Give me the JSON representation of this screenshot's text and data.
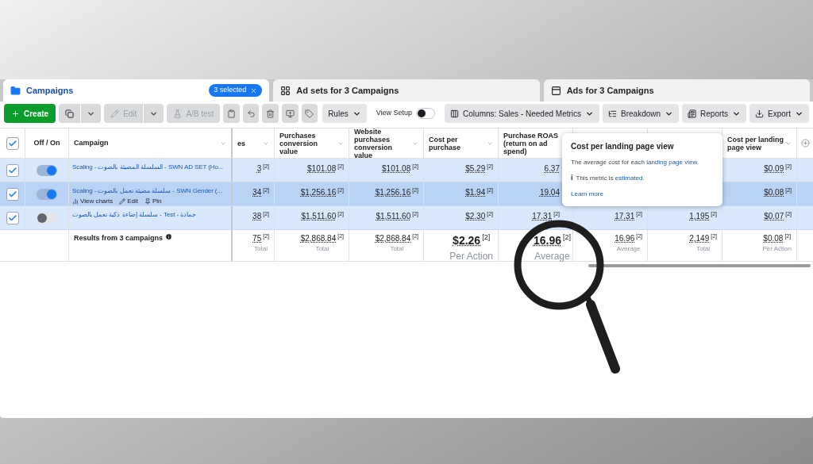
{
  "tabs": [
    {
      "label": "Campaigns",
      "selected": true,
      "badge": "3 selected"
    },
    {
      "label": "Ad sets for 3 Campaigns",
      "selected": false
    },
    {
      "label": "Ads for 3 Campaigns",
      "selected": false
    }
  ],
  "toolbar": [
    {
      "kind": "create",
      "label": "Create"
    },
    {
      "kind": "split"
    },
    {
      "kind": "split",
      "label": "Edit",
      "disabled": true
    },
    {
      "kind": "button",
      "label": "A/B test",
      "disabled": true
    },
    {
      "kind": "icon"
    },
    {
      "kind": "icon"
    },
    {
      "kind": "icon"
    },
    {
      "kind": "icon"
    },
    {
      "kind": "icon"
    },
    {
      "kind": "menu",
      "label": "Rules"
    },
    {
      "kind": "switch",
      "label": "View Setup",
      "on": false
    },
    {
      "kind": "menu",
      "label": "Columns: Sales - Needed Metrics"
    },
    {
      "kind": "menu",
      "label": "Breakdown"
    },
    {
      "kind": "menu",
      "label": "Reports"
    },
    {
      "kind": "menu",
      "label": "Export"
    }
  ],
  "table": {
    "all_checked": true,
    "onoff_label": "Off / On",
    "name_label": "Campaign",
    "columns": [
      {
        "label": "es",
        "menu": true
      },
      {
        "label": "Purchases conversion value",
        "menu": true
      },
      {
        "label": "Website purchases conversion value",
        "menu": true
      },
      {
        "label": "Cost per purchase",
        "menu": true
      },
      {
        "label": "Purchase ROAS (return on ad spend)"
      },
      {},
      {},
      {
        "label": "Cost per landing page view",
        "menu": true
      }
    ],
    "rows": [
      {
        "checked": true,
        "on": true,
        "hovered": false,
        "name": "Scaling - السلسلة المضيئة بالصوت - SWN AD SET (Ho...",
        "values": [
          {
            "v": "3",
            "note": "[2]"
          },
          {
            "v": "$101.08",
            "note": "[2]"
          },
          {
            "v": "$101.08",
            "note": "[2]"
          },
          {
            "v": "$5.29",
            "note": "[2]"
          },
          {
            "v": "6.37"
          }
        ],
        "values_right": [
          {
            "v": "$0.09",
            "note": "[2]"
          }
        ]
      },
      {
        "checked": true,
        "on": true,
        "hovered": true,
        "name": "Scaling - سلسلة مضيئة تعمل بالصوت - SWN Gender (...",
        "actions": [
          "View charts",
          "Edit",
          "Pin"
        ],
        "values": [
          {
            "v": "34",
            "note": "[2]"
          },
          {
            "v": "$1,256.16",
            "note": "[2]"
          },
          {
            "v": "$1,256.16",
            "note": "[2]"
          },
          {
            "v": "$1.94",
            "note": "[2]"
          },
          {
            "v": "19.04"
          }
        ],
        "values_right": [
          {
            "v": "$0.08",
            "note": "[2]"
          }
        ]
      },
      {
        "checked": true,
        "on": false,
        "hovered": false,
        "name": "سلسلة إضاءة ذكية تعمل بالصوت - Test - حمادة",
        "values": [
          {
            "v": "38",
            "note": "[2]"
          },
          {
            "v": "$1,511.60",
            "note": "[2]"
          },
          {
            "v": "$1,511.60",
            "note": "[2]"
          },
          {
            "v": "$2.30",
            "note": "[2]"
          },
          {
            "v": "17.31",
            "note": "[2]"
          }
        ],
        "values_right": [
          {
            "v": "17.31",
            "note": "[2]"
          },
          {
            "v": "1,195",
            "note": "[2]"
          },
          {
            "v": "$0.07",
            "note": "[2]"
          }
        ]
      }
    ],
    "totals": {
      "label": "Results from 3 campaigns",
      "values": [
        {
          "v": "75",
          "note": "[2]",
          "caption": "Total",
          "enlarged": false
        },
        {
          "v": "$2,868.84",
          "note": "[2]",
          "caption": "Total",
          "enlarged": false
        },
        {
          "v": "$2,868.84",
          "note": "[2]",
          "caption": "Total",
          "enlarged": false
        },
        {
          "v": "$2.26",
          "note": "[2]",
          "caption": "Per Action",
          "enlarged": true
        },
        {
          "v": "16.96",
          "note": "[2]",
          "caption": "Average",
          "enlarged": true
        },
        {
          "v": "16.96",
          "note": "[2]",
          "caption": "Average",
          "enlarged": false
        },
        {
          "v": "2,149",
          "note": "[2]",
          "caption": "Total",
          "enlarged": false
        },
        {
          "v": "$0.08",
          "note": "[2]",
          "caption": "Per Action",
          "enlarged": false
        }
      ]
    }
  },
  "tooltip": {
    "title": "Cost per landing page view",
    "body": "The average cost for each ",
    "body_link": "landing page view",
    "body_end": ".",
    "info_mark": "i",
    "info": "This metric is ",
    "info_link": "estimated",
    "info_end": ".",
    "learn_more": "Learn more"
  }
}
